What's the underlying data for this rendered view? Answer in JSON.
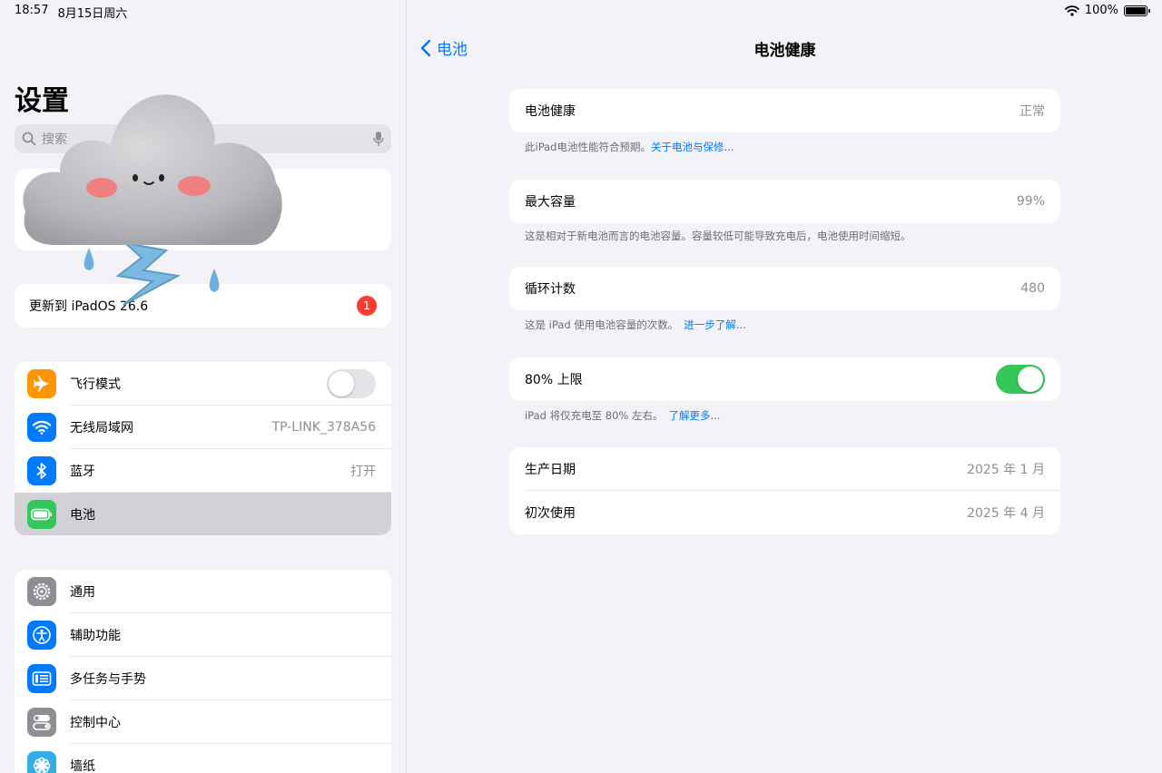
{
  "status": {
    "time": "18:57",
    "date": "8月15日周六",
    "battery": "100%",
    "wifi_icon": "wifi-icon",
    "battery_level": 1.0
  },
  "sidebar": {
    "title": "设置",
    "search_placeholder": "搜索",
    "update": {
      "label": "更新到 iPadOS 26.6",
      "badge": "1"
    },
    "group1": [
      {
        "label": "飞行模式",
        "icon": "airplane-icon",
        "color": "#ff9500",
        "toggle": false
      },
      {
        "label": "无线局域网",
        "icon": "wifi-icon",
        "color": "#007aff",
        "value": "TP-LINK_378A56"
      },
      {
        "label": "蓝牙",
        "icon": "bluetooth-icon",
        "color": "#007aff",
        "value": "打开"
      },
      {
        "label": "电池",
        "icon": "battery-icon",
        "color": "#34c759",
        "selected": true
      }
    ],
    "group2": [
      {
        "label": "通用",
        "icon": "gear-icon",
        "color": "#8e8e93"
      },
      {
        "label": "辅助功能",
        "icon": "accessibility-icon",
        "color": "#007aff"
      },
      {
        "label": "多任务与手势",
        "icon": "multitasking-icon",
        "color": "#007aff"
      },
      {
        "label": "控制中心",
        "icon": "control-center-icon",
        "color": "#8e8e93"
      },
      {
        "label": "墙纸",
        "icon": "wallpaper-icon",
        "color": "#32ade6"
      }
    ]
  },
  "detail": {
    "back_label": "电池",
    "title": "电池健康",
    "health": {
      "label": "电池健康",
      "value": "正常",
      "note": "此iPad电池性能符合预期。",
      "note_link": "关于电池与保修..."
    },
    "capacity": {
      "label": "最大容量",
      "value": "99%",
      "note": "这是相对于新电池而言的电池容量。容量较低可能导致充电后，电池使用时间缩短。"
    },
    "cycles": {
      "label": "循环计数",
      "value": "480",
      "note": "这是 iPad 使用电池容量的次数。",
      "note_link": "进一步了解..."
    },
    "limit": {
      "label": "80% 上限",
      "toggle": true,
      "note": "iPad 将仅充电至 80% 左右。",
      "note_link": "了解更多..."
    },
    "dates": [
      {
        "label": "生产日期",
        "value": "2025 年 1 月"
      },
      {
        "label": "初次使用",
        "value": "2025 年 4 月"
      }
    ]
  },
  "colors": {
    "accent": "#007aff",
    "toggle_on": "#34c759",
    "badge": "#ff3b30",
    "background": "#f2f2f7"
  }
}
